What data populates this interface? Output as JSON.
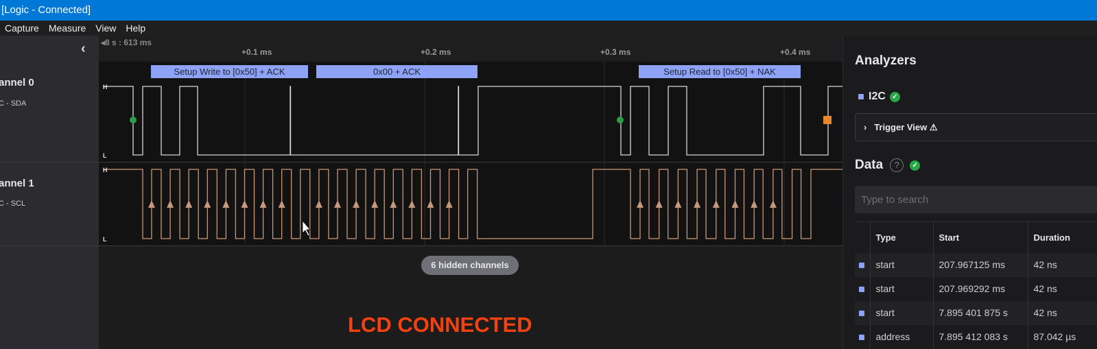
{
  "window": {
    "title": "[Logic - Connected]"
  },
  "menu": [
    "Capture",
    "Measure",
    "View",
    "Help"
  ],
  "timeline": {
    "origin": "◂8 s : 613 ms",
    "ticks": [
      "+0.1 ms",
      "+0.2 ms",
      "+0.3 ms",
      "+0.4 ms"
    ]
  },
  "channels": [
    {
      "name": "annel 0",
      "sub": "C - SDA",
      "color": "#d8d8d8"
    },
    {
      "name": "annel 1",
      "sub": "C - SCL",
      "color": "#c8987a"
    }
  ],
  "levels": {
    "high": "H",
    "low": "L"
  },
  "annotations": [
    "Setup Write to [0x50] + ACK",
    "0x00 + ACK",
    "Setup Read to [0x50] + NAK"
  ],
  "hidden_channels": "6 hidden channels",
  "overlay_text": "LCD CONNECTED",
  "analyzers": {
    "title": "Analyzers",
    "items": [
      {
        "name": "I2C",
        "color": "#8ea2f6",
        "status": "ok"
      }
    ],
    "trigger_view": "Trigger View",
    "data_title": "Data",
    "search_placeholder": "Type to search",
    "columns": [
      "Type",
      "Start",
      "Duration"
    ],
    "rows": [
      {
        "type": "start",
        "start": "207.967125 ms",
        "duration": "42 ns"
      },
      {
        "type": "start",
        "start": "207.969292 ms",
        "duration": "42 ns"
      },
      {
        "type": "start",
        "start": "7.895 401 875 s",
        "duration": "42 ns"
      },
      {
        "type": "address",
        "start": "7.895 412 083 s",
        "duration": "87.042 µs"
      }
    ]
  },
  "colors": {
    "accent": "#0078d7",
    "annotation": "#8ea2f6",
    "sda": "#d8d8d8",
    "scl": "#c8987a",
    "start_marker": "#2a9d4a",
    "stop_marker": "#e8862c",
    "lcd_text": "#f4410f"
  }
}
